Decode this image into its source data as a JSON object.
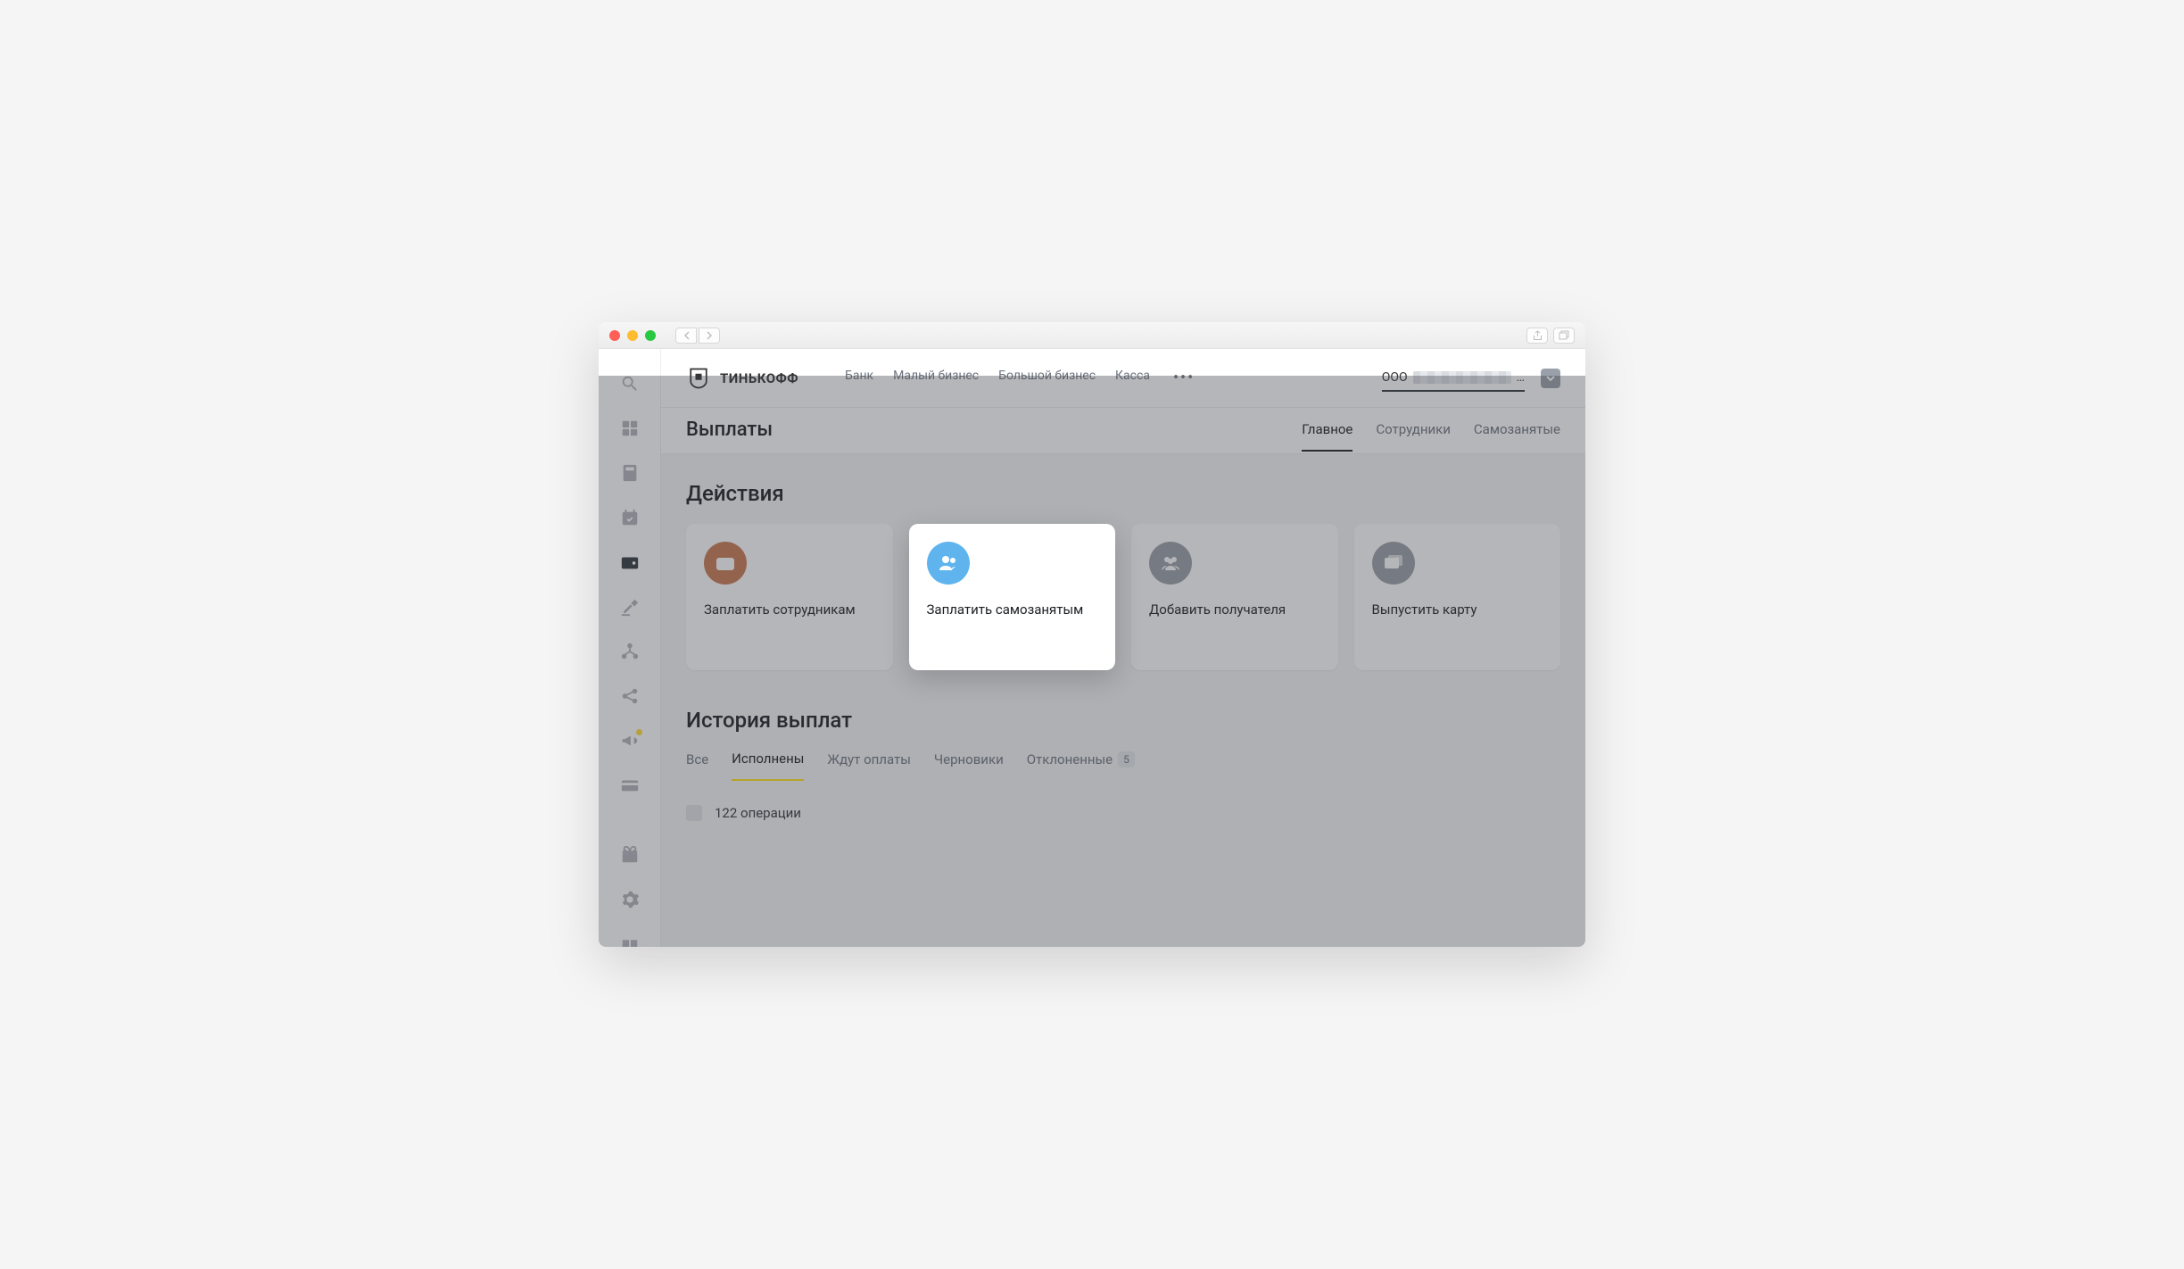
{
  "brand": "ТИНЬКОФФ",
  "topnav": {
    "bank": "Банк",
    "small": "Малый бизнес",
    "big": "Большой бизнес",
    "kassa": "Касса"
  },
  "account": {
    "prefix": "ООО"
  },
  "page_title": "Выплаты",
  "subtabs": {
    "main": "Главное",
    "employees": "Сотрудники",
    "self": "Самозанятые"
  },
  "actions": {
    "title": "Действия",
    "cards": {
      "pay_employees": "Заплатить сотрудникам",
      "pay_self": "Заплатить самозанятым",
      "add_recipient": "Добавить получателя",
      "issue_card": "Выпустить карту"
    }
  },
  "history": {
    "title": "История выплат",
    "tabs": {
      "all": "Все",
      "done": "Исполнены",
      "pending": "Ждут оплаты",
      "drafts": "Черновики",
      "rejected": "Отклоненные",
      "rejected_count": "5"
    },
    "row_count": "122 операции"
  }
}
